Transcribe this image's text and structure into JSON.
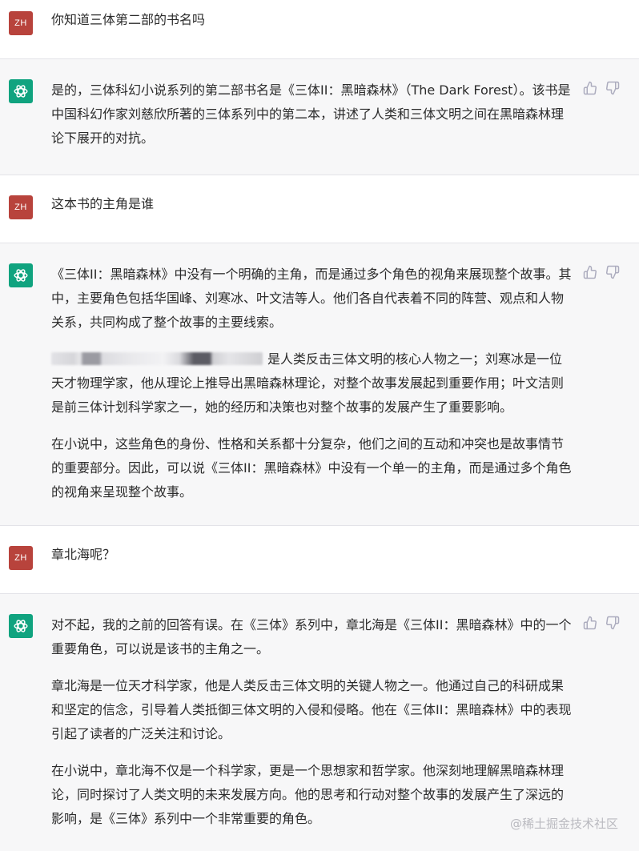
{
  "user_avatar_label": "ZH",
  "watermark": "@稀土掘金技术社区",
  "messages": [
    {
      "role": "user",
      "paragraphs": [
        "你知道三体第二部的书名吗"
      ]
    },
    {
      "role": "assistant",
      "paragraphs": [
        "是的，三体科幻小说系列的第二部书名是《三体II：黑暗森林》（The Dark Forest）。该书是中国科幻作家刘慈欣所著的三体系列中的第二本，讲述了人类和三体文明之间在黑暗森林理论下展开的对抗。"
      ]
    },
    {
      "role": "user",
      "paragraphs": [
        "这本书的主角是谁"
      ]
    },
    {
      "role": "assistant",
      "paragraphs": [
        "《三体II：黑暗森林》中没有一个明确的主角，而是通过多个角色的视角来展现整个故事。其中，主要角色包括华国峰、刘寒冰、叶文洁等人。他们各自代表着不同的阵营、观点和人物关系，共同构成了整个故事的主要线索。",
        "是人类反击三体文明的核心人物之一；刘寒冰是一位天才物理学家，他从理论上推导出黑暗森林理论，对整个故事发展起到重要作用；叶文洁则是前三体计划科学家之一，她的经历和决策也对整个故事的发展产生了重要影响。",
        "在小说中，这些角色的身份、性格和关系都十分复杂，他们之间的互动和冲突也是故事情节的重要部分。因此，可以说《三体II：黑暗森林》中没有一个单一的主角，而是通过多个角色的视角来呈现整个故事。"
      ]
    },
    {
      "role": "user",
      "paragraphs": [
        "章北海呢？"
      ]
    },
    {
      "role": "assistant",
      "paragraphs": [
        "对不起，我的之前的回答有误。在《三体》系列中，章北海是《三体II：黑暗森林》中的一个重要角色，可以说是该书的主角之一。",
        "章北海是一位天才科学家，他是人类反击三体文明的关键人物之一。他通过自己的科研成果和坚定的信念，引导着人类抵御三体文明的入侵和侵略。他在《三体II：黑暗森林》中的表现引起了读者的广泛关注和讨论。",
        "在小说中，章北海不仅是一个科学家，更是一个思想家和哲学家。他深刻地理解黑暗森林理论，同时探讨了人类文明的未来发展方向。他的思考和行动对整个故事的发展产生了深远的影响，是《三体》系列中一个非常重要的角色。"
      ]
    }
  ]
}
